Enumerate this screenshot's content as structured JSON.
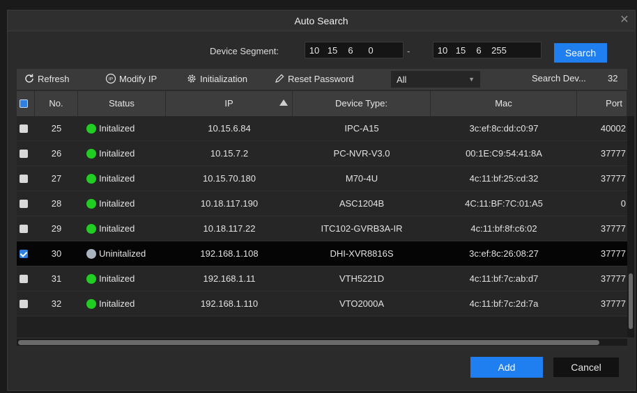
{
  "dialog": {
    "title": "Auto Search",
    "close_glyph": "✕"
  },
  "segment": {
    "label": "Device Segment:",
    "start": [
      "10",
      "15",
      "6",
      "0"
    ],
    "separator": "-",
    "end": [
      "10",
      "15",
      "6",
      "255"
    ],
    "search_label": "Search"
  },
  "toolbar": {
    "refresh_label": "Refresh",
    "modify_ip_label": "Modify IP",
    "initialization_label": "Initialization",
    "reset_password_label": "Reset Password",
    "filter_value": "All",
    "search_count_label": "Search Dev...",
    "search_count_value": "32"
  },
  "table": {
    "columns": [
      "No.",
      "Status",
      "IP",
      "Device Type:",
      "Mac",
      "Port"
    ],
    "rows": [
      {
        "no": "25",
        "status": "Initalized",
        "ip": "10.15.6.84",
        "type": "IPC-A15",
        "mac": "3c:ef:8c:dd:c0:97",
        "port": "40002",
        "checked": false,
        "status_color": "#22cc22"
      },
      {
        "no": "26",
        "status": "Initalized",
        "ip": "10.15.7.2",
        "type": "PC-NVR-V3.0",
        "mac": "00:1E:C9:54:41:8A",
        "port": "37777",
        "checked": false,
        "status_color": "#22cc22"
      },
      {
        "no": "27",
        "status": "Initalized",
        "ip": "10.15.70.180",
        "type": "M70-4U",
        "mac": "4c:11:bf:25:cd:32",
        "port": "37777",
        "checked": false,
        "status_color": "#22cc22"
      },
      {
        "no": "28",
        "status": "Initalized",
        "ip": "10.18.117.190",
        "type": "ASC1204B",
        "mac": "4C:11:BF:7C:01:A5",
        "port": "0",
        "checked": false,
        "status_color": "#22cc22"
      },
      {
        "no": "29",
        "status": "Initalized",
        "ip": "10.18.117.22",
        "type": "ITC102-GVRB3A-IR",
        "mac": "4c:11:bf:8f:c6:02",
        "port": "37777",
        "checked": false,
        "status_color": "#22cc22"
      },
      {
        "no": "30",
        "status": "Uninitalized",
        "ip": "192.168.1.108",
        "type": "DHI-XVR8816S",
        "mac": "3c:ef:8c:26:08:27",
        "port": "37777",
        "checked": true,
        "status_color": "#aab4c0"
      },
      {
        "no": "31",
        "status": "Initalized",
        "ip": "192.168.1.11",
        "type": "VTH5221D",
        "mac": "4c:11:bf:7c:ab:d7",
        "port": "37777",
        "checked": false,
        "status_color": "#22cc22"
      },
      {
        "no": "32",
        "status": "Initalized",
        "ip": "192.168.1.110",
        "type": "VTO2000A",
        "mac": "4c:11:bf:7c:2d:7a",
        "port": "37777",
        "checked": false,
        "status_color": "#22cc22"
      }
    ]
  },
  "footer": {
    "add_label": "Add",
    "cancel_label": "Cancel"
  },
  "colors": {
    "accent": "#1f7ff0",
    "initialized": "#22cc22",
    "uninitialized": "#aab4c0"
  }
}
